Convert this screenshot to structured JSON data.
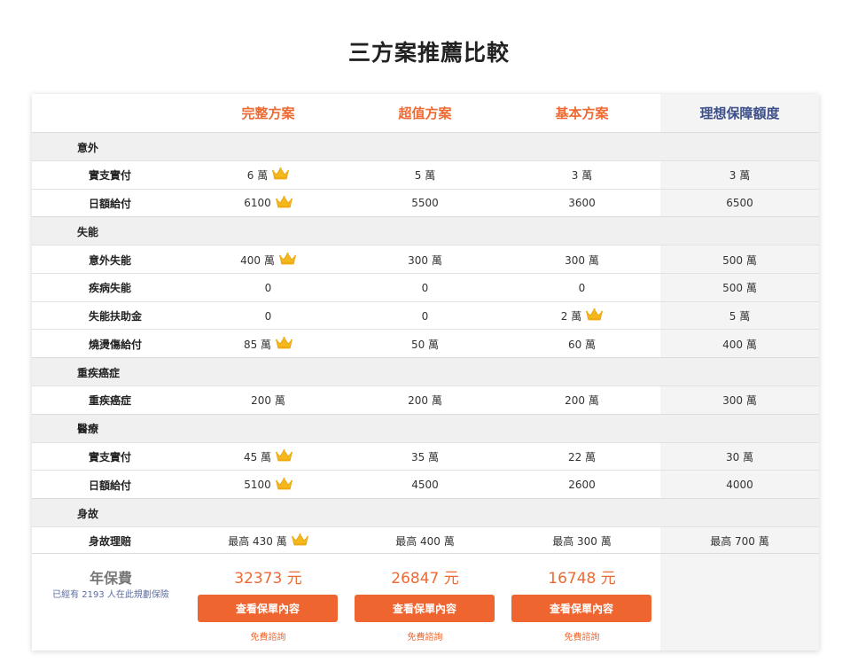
{
  "page_title": "三方案推薦比較",
  "columns": [
    "完整方案",
    "超值方案",
    "基本方案",
    "理想保障額度"
  ],
  "crown_icon": "crown-icon",
  "rows": [
    {
      "type": "category",
      "label": "意外"
    },
    {
      "type": "item",
      "label": "實支實付",
      "values": [
        "6 萬",
        "5 萬",
        "3 萬",
        "3 萬"
      ],
      "best": 0
    },
    {
      "type": "item",
      "label": "日額給付",
      "values": [
        "6100",
        "5500",
        "3600",
        "6500"
      ],
      "best": 0
    },
    {
      "type": "category",
      "label": "失能"
    },
    {
      "type": "item",
      "label": "意外失能",
      "values": [
        "400 萬",
        "300 萬",
        "300 萬",
        "500 萬"
      ],
      "best": 0
    },
    {
      "type": "item",
      "label": "疾病失能",
      "values": [
        "0",
        "0",
        "0",
        "500 萬"
      ],
      "best": null
    },
    {
      "type": "item",
      "label": "失能扶助金",
      "values": [
        "0",
        "0",
        "2 萬",
        "5 萬"
      ],
      "best": 2
    },
    {
      "type": "item",
      "label": "燒燙傷給付",
      "values": [
        "85 萬",
        "50 萬",
        "60 萬",
        "400 萬"
      ],
      "best": 0
    },
    {
      "type": "category",
      "label": "重疾癌症"
    },
    {
      "type": "item",
      "label": "重疾癌症",
      "values": [
        "200 萬",
        "200 萬",
        "200 萬",
        "300 萬"
      ],
      "best": null
    },
    {
      "type": "category",
      "label": "醫療"
    },
    {
      "type": "item",
      "label": "實支實付",
      "values": [
        "45 萬",
        "35 萬",
        "22 萬",
        "30 萬"
      ],
      "best": 0
    },
    {
      "type": "item",
      "label": "日額給付",
      "values": [
        "5100",
        "4500",
        "2600",
        "4000"
      ],
      "best": 0
    },
    {
      "type": "category",
      "label": "身故"
    },
    {
      "type": "item",
      "label": "身故理賠",
      "values": [
        "最高 430 萬",
        "最高 400 萬",
        "最高 300 萬",
        "最高 700 萬"
      ],
      "best": 0
    }
  ],
  "footer": {
    "fee_label": "年保費",
    "user_count": "已經有 2193 人在此規劃保險",
    "prices": [
      "32373 元",
      "26847 元",
      "16748 元"
    ],
    "button_label": "查看保單內容",
    "consult_label": "免費諮詢"
  }
}
